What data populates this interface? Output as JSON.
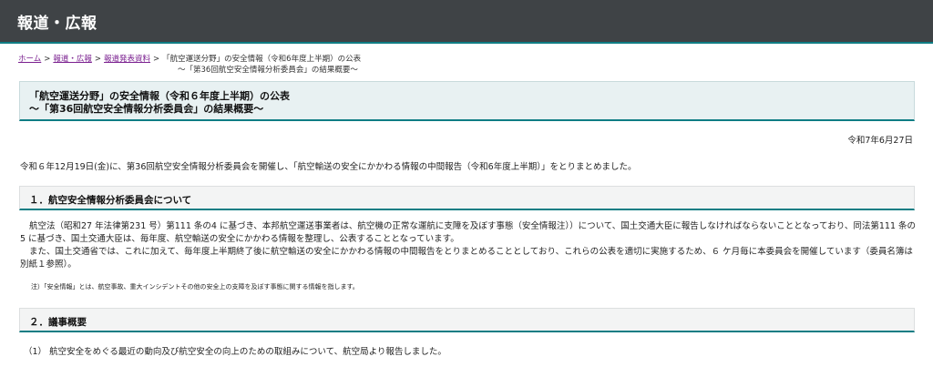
{
  "header": {
    "title": "報道・広報"
  },
  "breadcrumb": {
    "home": "ホーム",
    "press": "報道・広報",
    "releases": "報道発表資料",
    "separator": ">",
    "current_line1": "「航空運送分野」の安全情報（令和6年度上半期）の公表",
    "current_line2": "～「第36回航空安全情報分析委員会」の結果概要～"
  },
  "title": {
    "line1": "「航空運送分野」の安全情報（令和６年度上半期）の公表",
    "line2": "～「第36回航空安全情報分析委員会」の結果概要～"
  },
  "date": "令和7年6月27日",
  "intro": "令和６年12月19日(金)に、第36回航空安全情報分析委員会を開催し、「航空輸送の安全にかかわる情報の中間報告（令和6年度上半期）」をとりまとめました。",
  "section1": {
    "heading": "１．航空安全情報分析委員会について",
    "para1": "航空法（昭和27 年法律第231 号）第111 条の4 に基づき、本邦航空運送事業者は、航空機の正常な運航に支障を及ぼす事態（安全情報注））について、国土交通大臣に報告しなければならないこととなっており、同法第111 条の5 に基づき、国土交通大臣は、毎年度、航空輸送の安全にかかわる情報を整理し、公表することとなっています。",
    "para2": "また、国土交通省では、これに加えて、毎年度上半期終了後に航空輸送の安全にかかわる情報の中間報告をとりまとめることとしており、これらの公表を適切に実施するため、６ ケ月毎に本委員会を開催しています（委員名簿は別紙１参照）。",
    "note": "注）「安全情報」とは、航空事故、重大インシデントその他の安全上の支障を及ぼす事態に関する情報を指します。"
  },
  "section2": {
    "heading": "２．議事概要",
    "item1": "（1） 航空安全をめぐる最近の動向及び航空安全の向上のための取組みについて、航空局より報告しました。"
  },
  "colors": {
    "header_bg": "#3f4346",
    "accent": "#0f7d84",
    "link": "#7a1f8f",
    "title_bg": "#e8f1f2"
  }
}
